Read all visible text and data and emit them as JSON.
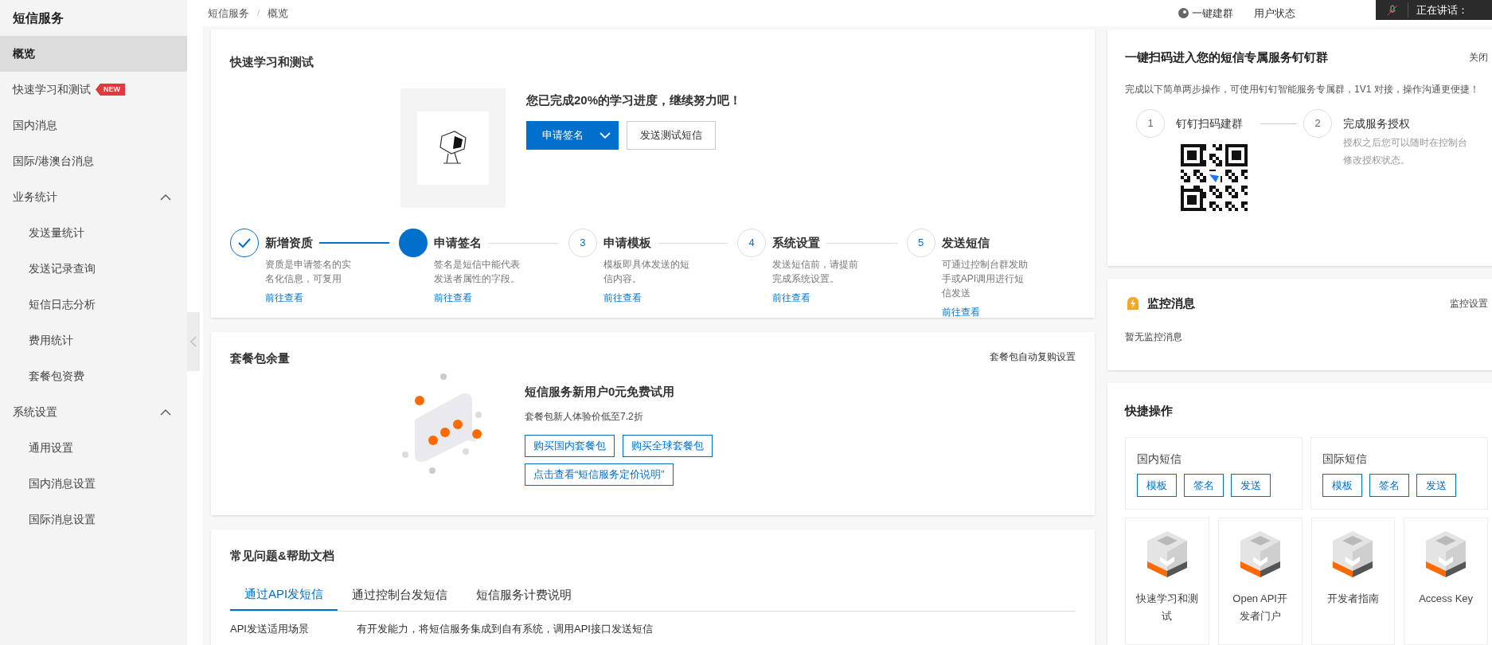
{
  "sidebar": {
    "title": "短信服务",
    "items": [
      {
        "label": "概览",
        "selected": true
      },
      {
        "label": "快速学习和测试",
        "badge": "NEW",
        "selected": false
      },
      {
        "label": "国内消息",
        "selected": false
      },
      {
        "label": "国际/港澳台消息",
        "selected": false
      },
      {
        "label": "业务统计",
        "expanded": true,
        "selected": false,
        "children": [
          {
            "label": "发送量统计",
            "selected": false
          },
          {
            "label": "发送记录查询",
            "selected": false
          },
          {
            "label": "短信日志分析",
            "selected": false
          },
          {
            "label": "费用统计",
            "selected": false
          },
          {
            "label": "套餐包资费",
            "selected": false
          }
        ]
      },
      {
        "label": "系统设置",
        "expanded": true,
        "selected": false,
        "children": [
          {
            "label": "通用设置",
            "selected": false
          },
          {
            "label": "国内消息设置",
            "selected": false
          },
          {
            "label": "国际消息设置",
            "selected": false
          }
        ]
      }
    ]
  },
  "breadcrumb": [
    "短信服务",
    "/",
    "概览"
  ],
  "header_links": [
    {
      "label": "一键建群"
    },
    {
      "label": "用户状态"
    }
  ],
  "speaking_overlay": {
    "text": "正在讲话："
  },
  "learn_card": {
    "title": "快速学习和测试",
    "progress_text": "您已完成20%的学习进度，继续努力吧！",
    "primary_button": "申请签名",
    "secondary_button": "发送测试短信",
    "steps": [
      {
        "kind": "done",
        "title": "新增资质",
        "description": "资质是申请签名的实名化信息，可复用",
        "link": "前往查看"
      },
      {
        "kind": "current",
        "title": "申请签名",
        "description": "签名是短信中能代表发送者属性的字段。",
        "link": "前往查看"
      },
      {
        "kind": "todo",
        "number": "3",
        "title": "申请模板",
        "description": "模板即具体发送的短信内容。",
        "link": "前往查看"
      },
      {
        "kind": "todo",
        "number": "4",
        "title": "系统设置",
        "description": "发送短信前，请提前完成系统设置。",
        "link": "前往查看"
      },
      {
        "kind": "todo",
        "number": "5",
        "title": "发送短信",
        "description": "可通过控制台群发助手或API调用进行短信发送",
        "link": "前往查看"
      }
    ]
  },
  "package_card": {
    "title": "套餐包余量",
    "link": "套餐包自动复购设置",
    "headline": "短信服务新用户0元免费试用",
    "subtext": "套餐包新人体验价低至7.2折",
    "buttons": [
      "购买国内套餐包",
      "购买全球套餐包",
      "点击查看“短信服务定价说明”"
    ]
  },
  "faq_card": {
    "title": "常见问题&帮助文档",
    "tabs": [
      {
        "label": "通过API发短信",
        "selected": true
      },
      {
        "label": "通过控制台发短信",
        "selected": false
      },
      {
        "label": "短信服务计费说明",
        "selected": false
      }
    ],
    "row": {
      "label": "API发送适用场景",
      "text": "有开发能力，将短信服务集成到自有系统，调用API接口发送短信"
    }
  },
  "dingtalk_card": {
    "title": "一键扫码进入您的短信专属服务钉钉群",
    "close": "关闭",
    "description": "完成以下简单两步操作，可使用钉钉智能服务专属群，1V1 对接，操作沟通更便捷！",
    "steps": [
      {
        "number": "1",
        "title": "钉钉扫码建群"
      },
      {
        "number": "2",
        "title": "完成服务授权",
        "description": "授权之后您可以随时在控制台修改授权状态。"
      }
    ]
  },
  "monitor_card": {
    "title": "监控消息",
    "link": "监控设置",
    "empty_text": "暂无监控消息"
  },
  "shortcuts_card": {
    "title": "快捷操作",
    "groups": [
      {
        "title": "国内短信",
        "buttons": [
          "模板",
          "签名",
          "发送"
        ]
      },
      {
        "title": "国际短信",
        "buttons": [
          "模板",
          "签名",
          "发送"
        ]
      }
    ],
    "tiles": [
      "快速学习和测试",
      "Open API开发者门户",
      "开发者指南",
      "Access Key"
    ]
  }
}
